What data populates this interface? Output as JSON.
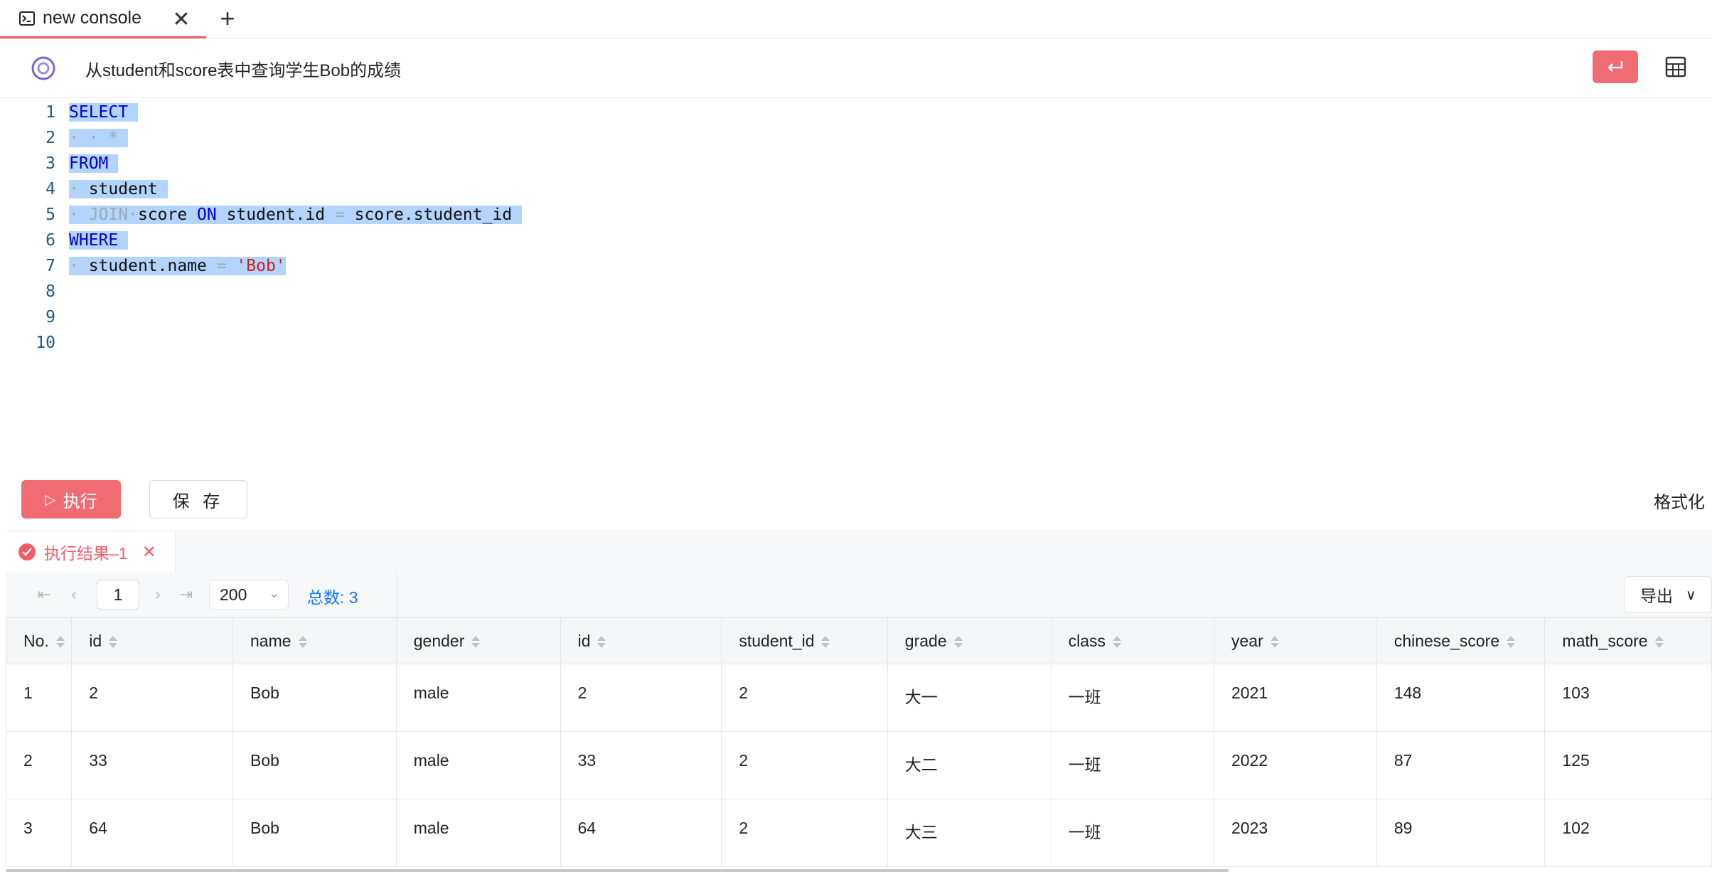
{
  "tab": {
    "label": "new console",
    "close": "✕",
    "add": "+"
  },
  "header": {
    "query_title": "从student和score表中查询学生Bob的成绩"
  },
  "editor": {
    "line_numbers": [
      "1",
      "2",
      "3",
      "4",
      "5",
      "6",
      "7",
      "8",
      "9",
      "10"
    ],
    "lines": [
      [
        {
          "t": "SELECT",
          "c": "kw"
        },
        {
          "t": " ",
          "c": "dim"
        }
      ],
      [
        {
          "t": "· · *",
          "c": "dim"
        },
        {
          "t": " ",
          "c": "dim"
        }
      ],
      [
        {
          "t": "FROM",
          "c": "kw"
        },
        {
          "t": " ",
          "c": "dim"
        }
      ],
      [
        {
          "t": "· ",
          "c": "dim"
        },
        {
          "t": "student",
          "c": "idn"
        },
        {
          "t": " ",
          "c": "dim"
        }
      ],
      [
        {
          "t": "· JOIN·",
          "c": "dim"
        },
        {
          "t": "score ",
          "c": "idn"
        },
        {
          "t": "ON ",
          "c": "kw"
        },
        {
          "t": "student.id ",
          "c": "idn"
        },
        {
          "t": "= ",
          "c": "dim"
        },
        {
          "t": "score.student_id ",
          "c": "idn"
        }
      ],
      [
        {
          "t": "WHERE",
          "c": "kw"
        },
        {
          "t": " ",
          "c": "dim"
        }
      ],
      [
        {
          "t": "· ",
          "c": "dim"
        },
        {
          "t": "student.name ",
          "c": "idn"
        },
        {
          "t": "= ",
          "c": "dim"
        },
        {
          "t": "'Bob'",
          "c": "str"
        }
      ]
    ]
  },
  "actions": {
    "run_label": "执行",
    "save_label": "保 存",
    "format_label": "格式化"
  },
  "results": {
    "tab_label": "执行结果–1",
    "pager": {
      "current_page": "1",
      "page_size": "200",
      "total_text": "总数: 3"
    },
    "export_label": "导出",
    "columns": [
      "No.",
      "id",
      "name",
      "gender",
      "id",
      "student_id",
      "grade",
      "class",
      "year",
      "chinese_score",
      "math_score"
    ],
    "rows": [
      [
        "1",
        "2",
        "Bob",
        "male",
        "2",
        "2",
        "大一",
        "一班",
        "2021",
        "148",
        "103"
      ],
      [
        "2",
        "33",
        "Bob",
        "male",
        "33",
        "2",
        "大二",
        "一班",
        "2022",
        "87",
        "125"
      ],
      [
        "3",
        "64",
        "Bob",
        "male",
        "64",
        "2",
        "大三",
        "一班",
        "2023",
        "89",
        "102"
      ]
    ]
  },
  "colors": {
    "accent": "#f16b73",
    "selection": "#b3d4fb",
    "keyword": "#0000d9",
    "string": "#d21e1e",
    "link": "#1677ff"
  }
}
